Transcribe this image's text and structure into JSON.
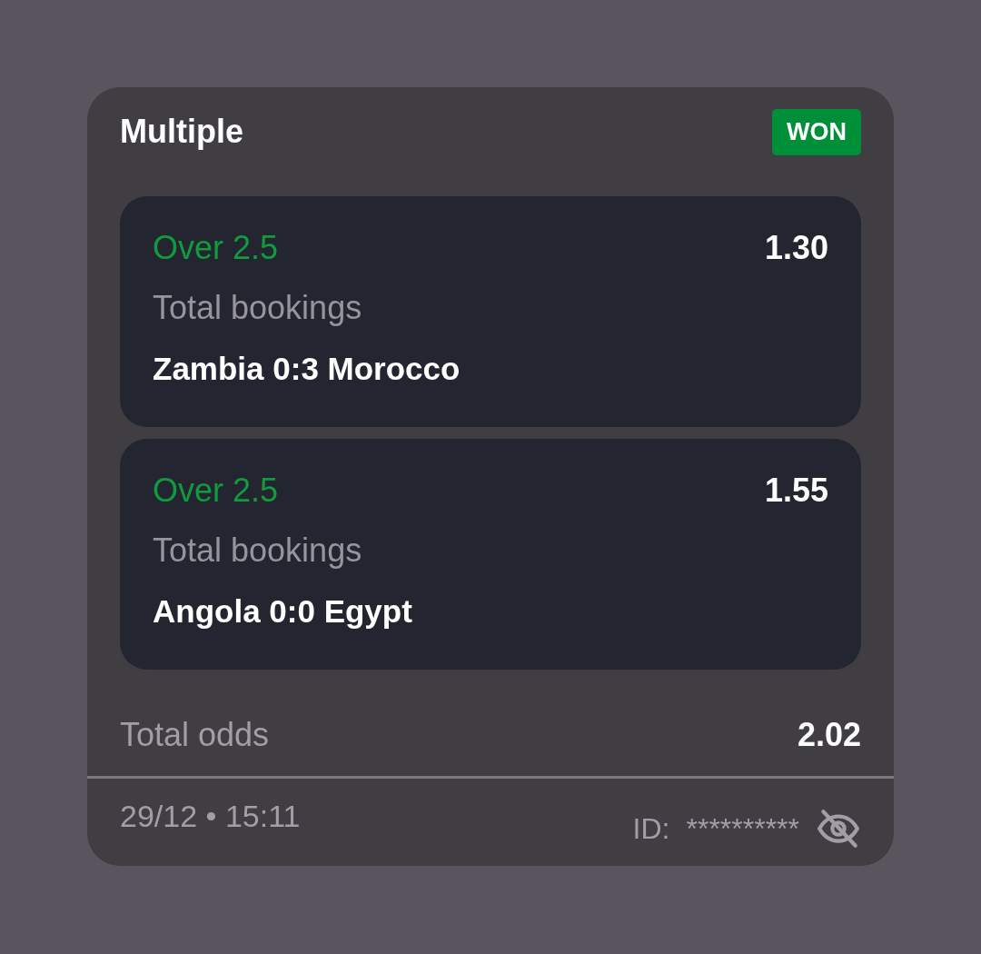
{
  "bet": {
    "title": "Multiple",
    "status": "WON"
  },
  "selections": [
    {
      "pick": "Over 2.5",
      "odds": "1.30",
      "market": "Total bookings",
      "match": "Zambia 0:3 Morocco"
    },
    {
      "pick": "Over 2.5",
      "odds": "1.55",
      "market": "Total bookings",
      "match": "Angola 0:0 Egypt"
    }
  ],
  "total": {
    "label": "Total odds",
    "value": "2.02"
  },
  "footer": {
    "datetime": "29/12 • 15:11",
    "id_label": "ID:",
    "id_value": "**********",
    "id_hidden": true
  }
}
